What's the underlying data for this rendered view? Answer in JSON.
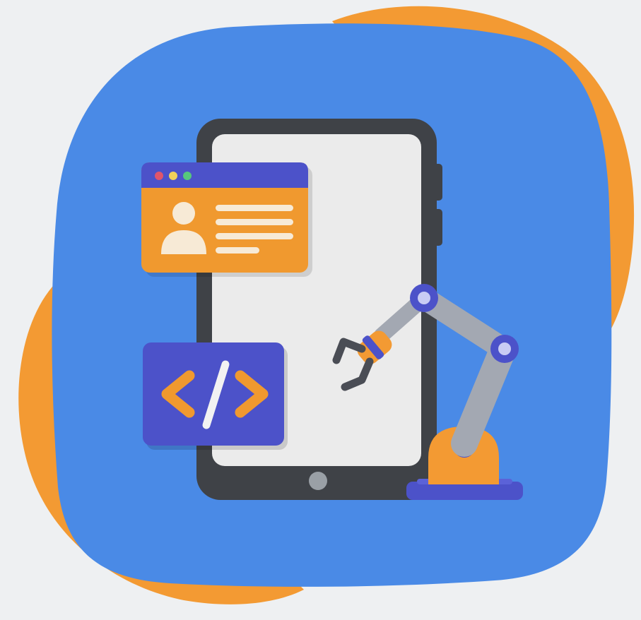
{
  "colors": {
    "background": "#eef0f2",
    "blue_blob": "#4a8ae6",
    "orange_blob": "#f39a33",
    "tablet_frame": "#3f4247",
    "tablet_screen": "#ebebeb",
    "orange_card": "#f0992f",
    "indigo": "#4c52c9",
    "robot_gray": "#a3a8b2",
    "dot_red": "#e0556b",
    "dot_yellow": "#f2d05a",
    "dot_green": "#57c77c"
  },
  "icons": [
    "tablet-icon",
    "profile-window-icon",
    "user-avatar-icon",
    "code-tag-icon",
    "robot-arm-icon",
    "gripper-claw-icon"
  ]
}
